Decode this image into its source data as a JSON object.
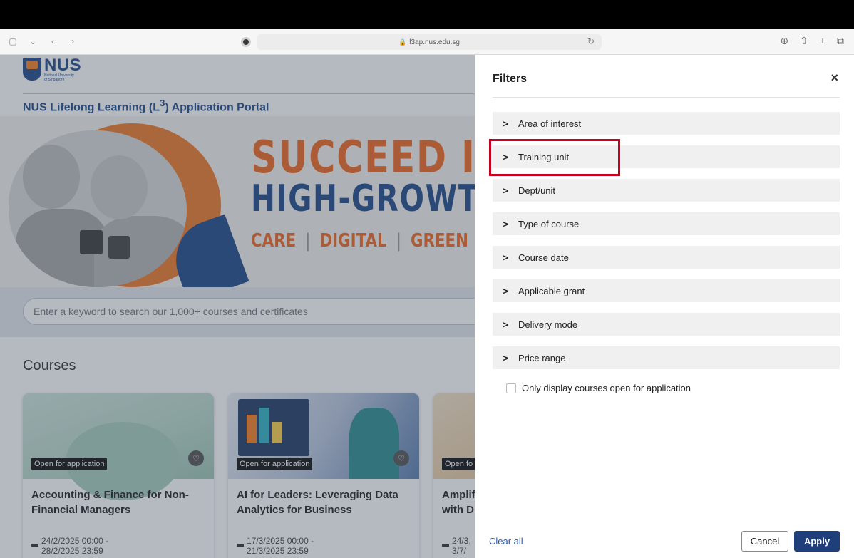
{
  "browser": {
    "url": "l3ap.nus.edu.sg"
  },
  "header": {
    "logo_text": "NUS",
    "logo_subtitle_1": "National University",
    "logo_subtitle_2": "of Singapore",
    "portal_title_prefix": "NUS Lifelong Learning (L",
    "portal_title_sup": "3",
    "portal_title_suffix": ") Application Portal"
  },
  "hero": {
    "line1": "SUCCEED I",
    "line2": "HIGH-GROWTH",
    "word1": "CARE",
    "word2": "DIGITAL",
    "word3": "GREEN",
    "separator": "|"
  },
  "search": {
    "placeholder": "Enter a keyword to search our 1,000+ courses and certificates"
  },
  "courses": {
    "heading": "Courses",
    "items": [
      {
        "badge": "Open for application",
        "title": "Accounting & Finance for Non-Financial Managers",
        "date_line1": "24/2/2025 00:00 -",
        "date_line2": "28/2/2025 23:59"
      },
      {
        "badge": "Open for application",
        "title": "AI for Leaders: Leveraging Data Analytics for Business",
        "date_line1": "17/3/2025 00:00 -",
        "date_line2": "21/3/2025 23:59"
      },
      {
        "badge": "Open fo",
        "title": "Amplif with D",
        "date_line1": "24/3,",
        "date_line2": "3/7/"
      }
    ]
  },
  "filters": {
    "title": "Filters",
    "close": "×",
    "items": [
      "Area of interest",
      "Training unit",
      "Dept/unit",
      "Type of course",
      "Course date",
      "Applicable grant",
      "Delivery mode",
      "Price range"
    ],
    "checkbox_label": "Only display courses open for application",
    "clear_all": "Clear all",
    "cancel": "Cancel",
    "apply": "Apply"
  },
  "colors": {
    "brand_blue": "#1f4b8a",
    "brand_orange": "#ef6a22",
    "highlight_red": "#c8001e",
    "apply_bg": "#1f3f7a"
  }
}
